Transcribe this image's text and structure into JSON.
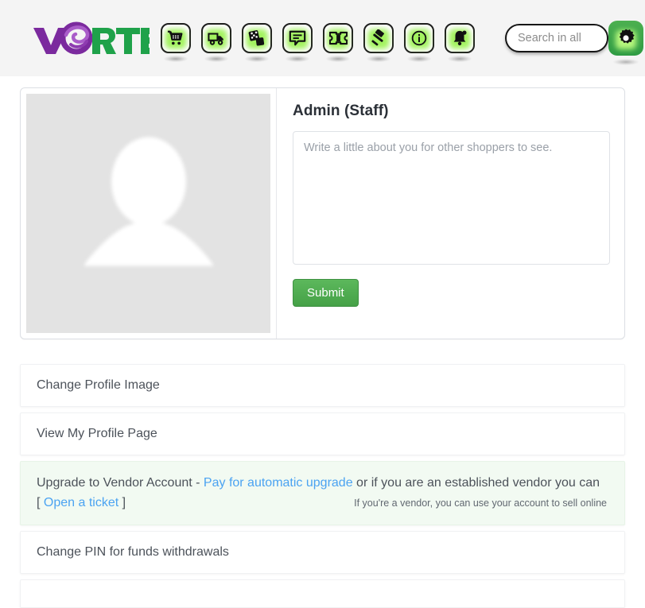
{
  "header": {
    "logo": {
      "text_primary": "V",
      "text_secondary": "RTEX",
      "alt": "Vortex logo",
      "color_primary": "#7b2a9e",
      "color_secondary": "#1fa24a"
    },
    "nav_icons": [
      {
        "name": "shopping-cart-icon",
        "label": "Cart"
      },
      {
        "name": "delivery-truck-icon",
        "label": "Shipping"
      },
      {
        "name": "dice-icon",
        "label": "Games"
      },
      {
        "name": "chat-bubble-icon",
        "label": "Messages"
      },
      {
        "name": "ticket-icon",
        "label": "Tickets"
      },
      {
        "name": "gavel-icon",
        "label": "Auctions"
      },
      {
        "name": "info-icon",
        "label": "Info"
      },
      {
        "name": "bell-icon",
        "label": "Notifications"
      }
    ],
    "search": {
      "placeholder": "Search in all",
      "value": ""
    },
    "settings_button": {
      "name": "gear-icon",
      "label": "Settings"
    }
  },
  "profile": {
    "avatar_alt": "Default profile silhouette",
    "name": "Admin (Staff)",
    "bio": {
      "placeholder": "Write a little about you for other shoppers to see.",
      "value": ""
    },
    "submit_label": "Submit"
  },
  "menu_rows": [
    {
      "label": "Change Profile Image"
    },
    {
      "label": "View My Profile Page"
    },
    {
      "label": "Change PIN for funds withdrawals"
    }
  ],
  "vendor_row": {
    "lead": "Upgrade to Vendor Account - ",
    "link_pay": "Pay for automatic upgrade",
    "middle": " or  if you are an established vendor you can",
    "bracket_open": "[ ",
    "link_ticket": "Open a ticket",
    "bracket_close": " ]",
    "note": "If you're a vendor, you can use your account to sell online",
    "background": "#f2faf2",
    "link_color": "#4ba3f2"
  }
}
